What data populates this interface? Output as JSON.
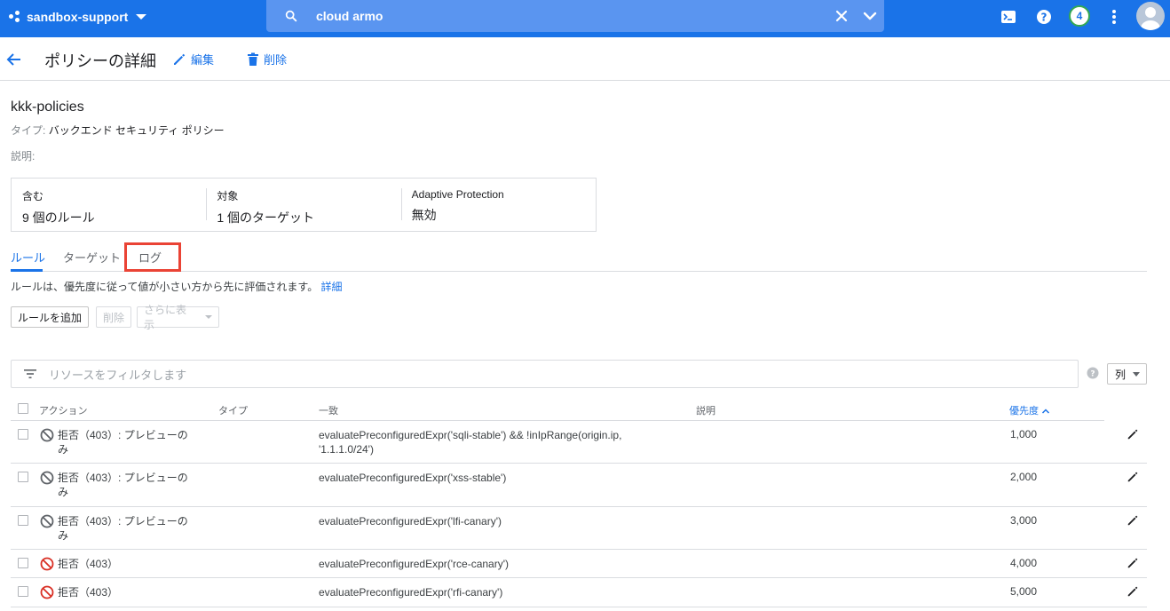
{
  "topbar": {
    "project": "sandbox-support",
    "search_value": "cloud armo",
    "notification_count": "4"
  },
  "header": {
    "title": "ポリシーの詳細",
    "edit_label": "編集",
    "delete_label": "削除"
  },
  "policy": {
    "name": "kkk-policies",
    "type_label": "タイプ:",
    "type_value": "バックエンド セキュリティ ポリシー",
    "description_label": "説明:"
  },
  "summary": [
    {
      "label": "含む",
      "value": "9 個のルール"
    },
    {
      "label": "対象",
      "value": "1 個のターゲット"
    },
    {
      "label": "Adaptive Protection",
      "value": "無効"
    }
  ],
  "tabs": [
    {
      "label": "ルール",
      "active": true
    },
    {
      "label": "ターゲット",
      "active": false
    },
    {
      "label": "ログ",
      "active": false
    }
  ],
  "info": {
    "text": "ルールは、優先度に従って値が小さい方から先に評価されます。",
    "link": "詳細"
  },
  "actions": {
    "add_rule": "ルールを追加",
    "delete": "削除",
    "more": "さらに表示"
  },
  "filter": {
    "placeholder": "リソースをフィルタします",
    "columns_label": "列"
  },
  "table": {
    "columns": [
      "アクション",
      "タイプ",
      "一致",
      "説明",
      "優先度"
    ],
    "rows": [
      {
        "action": "拒否（403）: プレビューのみ",
        "preview": true,
        "match": "evaluatePreconfiguredExpr('sqli-stable') && !inIpRange(origin.ip, '1.1.1.0/24')",
        "priority": "1,000"
      },
      {
        "action": "拒否（403）: プレビューのみ",
        "preview": true,
        "match": "evaluatePreconfiguredExpr('xss-stable')",
        "priority": "2,000"
      },
      {
        "action": "拒否（403）: プレビューのみ",
        "preview": true,
        "match": "evaluatePreconfiguredExpr('lfi-canary')",
        "priority": "3,000"
      },
      {
        "action": "拒否（403）",
        "preview": false,
        "match": "evaluatePreconfiguredExpr('rce-canary')",
        "priority": "4,000"
      },
      {
        "action": "拒否（403）",
        "preview": false,
        "match": "evaluatePreconfiguredExpr('rfi-canary')",
        "priority": "5,000"
      }
    ]
  },
  "colors": {
    "brand_blue": "#1a73e8",
    "deny_red": "#d93025",
    "preview_gray": "#5f6368",
    "highlight_red": "#ea4335"
  }
}
